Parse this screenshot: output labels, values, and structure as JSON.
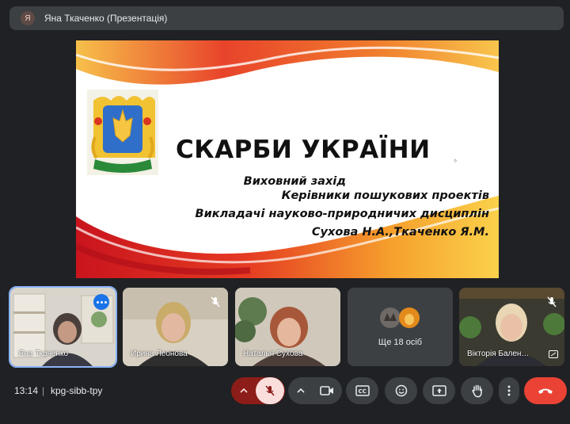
{
  "top_bar": {
    "avatar_letter": "Я",
    "presenter_title": "Яна Ткаченко (Презентація)"
  },
  "slide": {
    "title": "СКАРБИ УКРАЇНИ",
    "line1": "Виховний захід",
    "line2": "Керівники пошукових проектів",
    "line3": "Викладачі науково-природничих дисциплін",
    "line4": "Сухова Н.А.,Ткаченко Я.М.",
    "cursor_mark": "ᵇ"
  },
  "participants": [
    {
      "name": "Яна Ткаченко",
      "muted": false,
      "active": true
    },
    {
      "name": "Ирина Леонова",
      "muted": true,
      "active": false
    },
    {
      "name": "Наталья Сухова",
      "muted": false,
      "active": false
    },
    {
      "name": "Ще 18 осіб",
      "muted": false,
      "active": false
    },
    {
      "name": "Вікторія Бален…",
      "muted": true,
      "active": false
    }
  ],
  "bottom_bar": {
    "time": "13:14",
    "separator": "|",
    "meeting_code": "kpg-sibb-tpy"
  },
  "controls": [
    {
      "icon": "chevron-up-icon"
    },
    {
      "icon": "mic-off-icon"
    },
    {
      "icon": "chevron-up-icon"
    },
    {
      "icon": "camera-icon"
    },
    {
      "icon": "captions-icon"
    },
    {
      "icon": "emoji-icon"
    },
    {
      "icon": "present-icon"
    },
    {
      "icon": "raise-hand-icon"
    },
    {
      "icon": "more-vert-icon"
    },
    {
      "icon": "hang-up-icon"
    }
  ],
  "colors": {
    "background": "#202124",
    "control": "#3c4043",
    "mic_red": "#8c1d18",
    "mic_pink": "#f9dedc",
    "hangup_red": "#ea4335",
    "accent_blue": "#8ab4f8"
  }
}
